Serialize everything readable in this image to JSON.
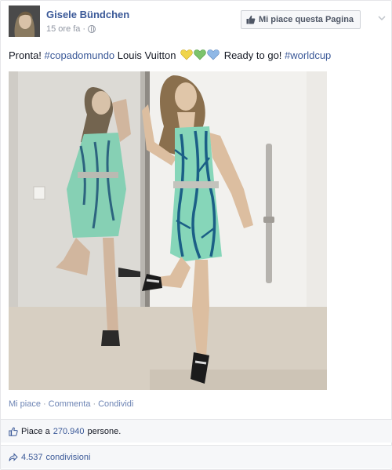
{
  "post": {
    "author": "Gisele Bündchen",
    "time": "15 ore fa",
    "meta_sep": "·",
    "like_page_button": "Mi piace questa Pagina",
    "text_parts": {
      "t1": "Pronta! ",
      "h1": "#copadomundo",
      "t2": " Louis Vuitton ",
      "t3": " Ready to go! ",
      "h2": "#worldcup"
    }
  },
  "actions": {
    "like": "Mi piace",
    "comment": "Commenta",
    "share": "Condividi",
    "sep": "·"
  },
  "stats": {
    "likes_prefix": "Piace a",
    "likes_count": "270.940",
    "likes_suffix": "persone.",
    "shares_count": "4.537",
    "shares_label": "condivisioni"
  },
  "icons": {
    "globe": "globe-icon",
    "thumb": "thumbs-up-icon",
    "share": "share-arrow-icon",
    "chevron": "chevron-down-icon",
    "hearts": "hearts-emoji"
  },
  "colors": {
    "link": "#3b5998",
    "muted": "#9197a3",
    "heart_yellow": "#f0d54a",
    "heart_green": "#7cc36b",
    "heart_blue": "#8fb8e6"
  }
}
